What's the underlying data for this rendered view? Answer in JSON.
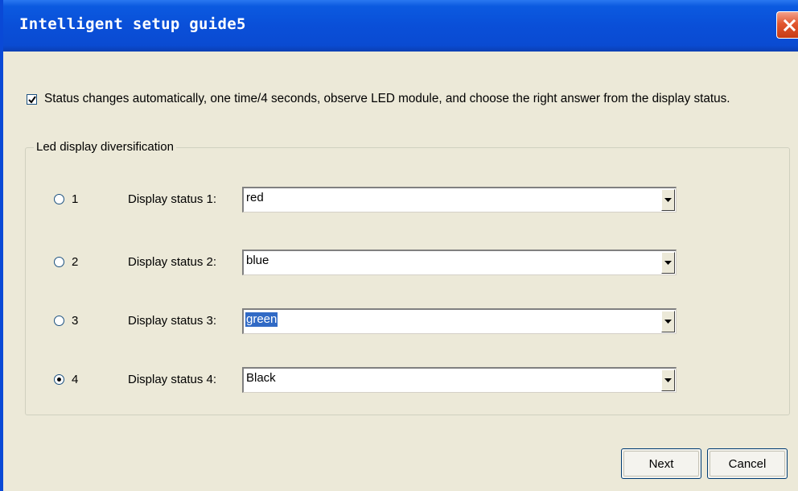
{
  "window": {
    "title": "Intelligent setup guide5",
    "titlebar_color": "#0a4bd2",
    "close_button_color": "#e2572f"
  },
  "auto_change": {
    "checked": true,
    "label": "Status changes automatically, one time/4 seconds, observe LED module, and choose the right answer from the display status."
  },
  "group": {
    "legend": "Led display diversification",
    "options": [
      {
        "radio_label": "1",
        "checked": false,
        "status_label": "Display status 1:",
        "value": "red",
        "selected": false
      },
      {
        "radio_label": "2",
        "checked": false,
        "status_label": "Display status 2:",
        "value": "blue",
        "selected": false
      },
      {
        "radio_label": "3",
        "checked": false,
        "status_label": "Display status 3:",
        "value": "green",
        "selected": true
      },
      {
        "radio_label": "4",
        "checked": true,
        "status_label": "Display status 4:",
        "value": "Black",
        "selected": false
      }
    ]
  },
  "buttons": {
    "next": "Next",
    "cancel": "Cancel"
  },
  "icons": {
    "close": "close-icon",
    "check": "checkmark-icon",
    "dropdown": "chevron-down-icon"
  },
  "colors": {
    "dialog_background": "#ece9d8",
    "selection_highlight": "#316ac5"
  }
}
